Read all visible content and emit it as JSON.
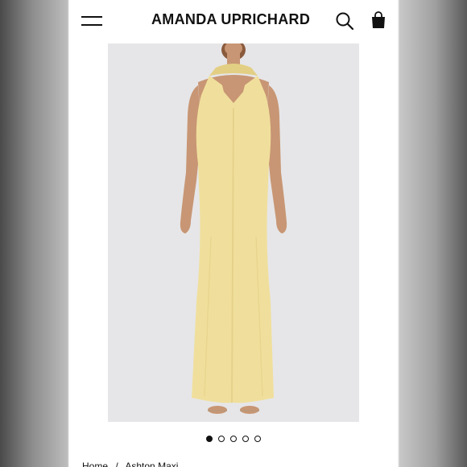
{
  "header": {
    "brand": "AMANDA UPRICHARD",
    "menu_icon": "hamburger-menu-icon",
    "search_icon": "search-icon",
    "cart_icon": "shopping-bag-icon"
  },
  "product": {
    "image_alt": "",
    "dress_color": "#f0df9c",
    "gallery_dots": [
      {
        "active": true
      },
      {
        "active": false
      },
      {
        "active": false
      },
      {
        "active": false
      },
      {
        "active": false
      }
    ]
  },
  "breadcrumb": {
    "home": "Home",
    "separator": "/",
    "current": "Ashton Maxi"
  }
}
